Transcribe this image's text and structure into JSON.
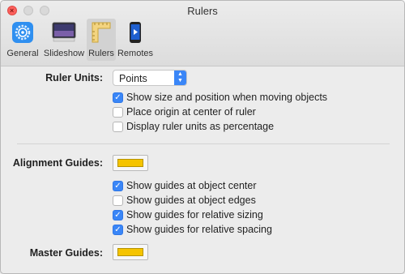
{
  "window": {
    "title": "Rulers"
  },
  "toolbar": {
    "tabs": [
      {
        "label": "General",
        "icon": "gear-icon"
      },
      {
        "label": "Slideshow",
        "icon": "slideshow-icon"
      },
      {
        "label": "Rulers",
        "icon": "ruler-icon",
        "selected": true
      },
      {
        "label": "Remotes",
        "icon": "phone-icon"
      }
    ]
  },
  "ruler_units": {
    "label": "Ruler Units:",
    "selected": "Points",
    "options": [
      {
        "label": "Show size and position when moving objects",
        "checked": true
      },
      {
        "label": "Place origin at center of ruler",
        "checked": false
      },
      {
        "label": "Display ruler units as percentage",
        "checked": false
      }
    ]
  },
  "alignment_guides": {
    "label": "Alignment Guides:",
    "color": "#f5c400",
    "options": [
      {
        "label": "Show guides at object center",
        "checked": true
      },
      {
        "label": "Show guides at object edges",
        "checked": false
      },
      {
        "label": "Show guides for relative sizing",
        "checked": true
      },
      {
        "label": "Show guides for relative spacing",
        "checked": true
      }
    ]
  },
  "master_guides": {
    "label": "Master Guides:",
    "color": "#f5c400"
  },
  "colors": {
    "accent": "#3a86f7",
    "close": "#fc605c"
  }
}
